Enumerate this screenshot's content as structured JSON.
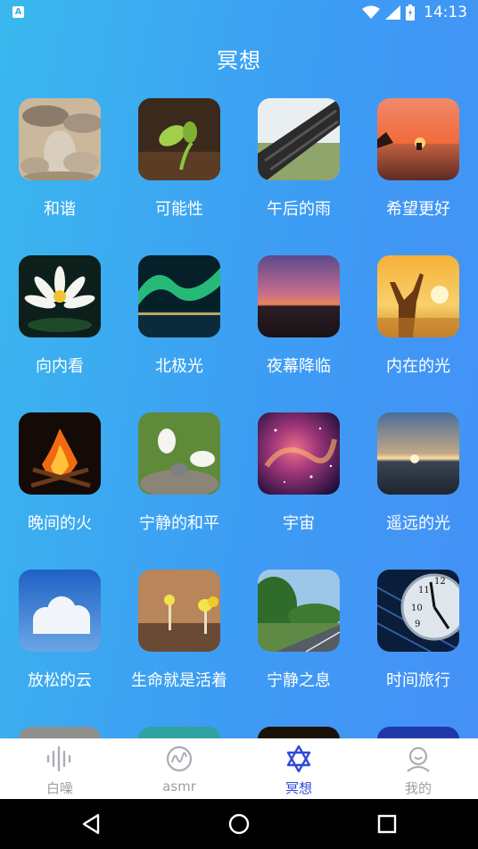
{
  "status_bar": {
    "time": "14:13",
    "notification_icon": "A"
  },
  "page_title": "冥想",
  "items": [
    {
      "label": "和谐",
      "image": "pebbles"
    },
    {
      "label": "可能性",
      "image": "sprout"
    },
    {
      "label": "午后的雨",
      "image": "roof-rain"
    },
    {
      "label": "希望更好",
      "image": "sunset-sea"
    },
    {
      "label": "向内看",
      "image": "lotus"
    },
    {
      "label": "北极光",
      "image": "aurora"
    },
    {
      "label": "夜幕降临",
      "image": "dusk"
    },
    {
      "label": "内在的光",
      "image": "sun-woman"
    },
    {
      "label": "晚间的火",
      "image": "campfire"
    },
    {
      "label": "宁静的和平",
      "image": "doves"
    },
    {
      "label": "宇宙",
      "image": "nebula"
    },
    {
      "label": "遥远的光",
      "image": "horizon"
    },
    {
      "label": "放松的云",
      "image": "clouds"
    },
    {
      "label": "生命就是活着",
      "image": "mushrooms"
    },
    {
      "label": "宁静之息",
      "image": "road"
    },
    {
      "label": "时间旅行",
      "image": "clock"
    }
  ],
  "tabs": [
    {
      "label": "白噪",
      "icon": "soundwave-icon",
      "active": false
    },
    {
      "label": "asmr",
      "icon": "asmr-wave-icon",
      "active": false
    },
    {
      "label": "冥想",
      "icon": "star-of-david-icon",
      "active": true
    },
    {
      "label": "我的",
      "icon": "profile-icon",
      "active": false
    }
  ],
  "colors": {
    "accent": "#2f4bd6",
    "inactive": "#9aa0a6",
    "gradient_start": "#3ab8ee",
    "gradient_end": "#4590f7"
  }
}
